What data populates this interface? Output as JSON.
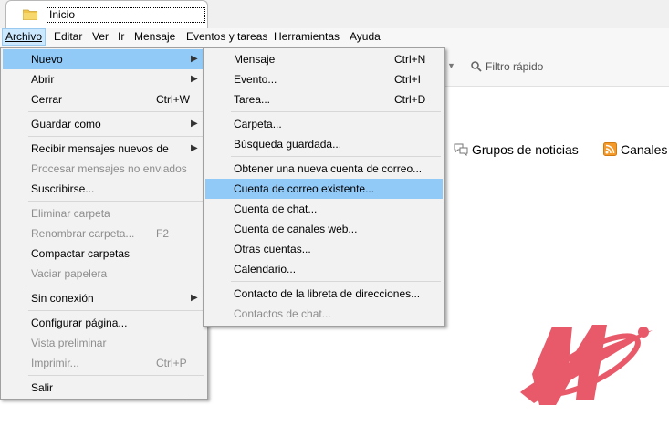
{
  "tab": {
    "title": "Inicio"
  },
  "menubar": [
    "Archivo",
    "Editar",
    "Ver",
    "Ir",
    "Mensaje",
    "Eventos y tareas",
    "Herramientas",
    "Ayuda"
  ],
  "background": {
    "quick_filter": "Filtro rápido",
    "newsgroups": "Grupos de noticias",
    "feeds": "Canales"
  },
  "archivo_menu": {
    "nuevo": "Nuevo",
    "abrir": "Abrir",
    "cerrar": "Cerrar",
    "cerrar_sc": "Ctrl+W",
    "guardar_como": "Guardar como",
    "recibir": "Recibir mensajes nuevos de",
    "procesar": "Procesar mensajes no enviados",
    "suscribirse": "Suscribirse...",
    "eliminar_carpeta": "Eliminar carpeta",
    "renombrar_carpeta": "Renombrar carpeta...",
    "renombrar_sc": "F2",
    "compactar": "Compactar carpetas",
    "vaciar_papelera": "Vaciar papelera",
    "sin_conexion": "Sin conexión",
    "configurar_pagina": "Configurar página...",
    "vista_preliminar": "Vista preliminar",
    "imprimir": "Imprimir...",
    "imprimir_sc": "Ctrl+P",
    "salir": "Salir"
  },
  "nuevo_menu": {
    "mensaje": "Mensaje",
    "mensaje_sc": "Ctrl+N",
    "evento": "Evento...",
    "evento_sc": "Ctrl+I",
    "tarea": "Tarea...",
    "tarea_sc": "Ctrl+D",
    "carpeta": "Carpeta...",
    "busqueda": "Búsqueda guardada...",
    "obtener_cuenta": "Obtener una nueva cuenta de correo...",
    "cuenta_existente": "Cuenta de correo existente...",
    "cuenta_chat": "Cuenta de chat...",
    "cuenta_canales": "Cuenta de canales web...",
    "otras_cuentas": "Otras cuentas...",
    "calendario": "Calendario...",
    "contacto": "Contacto de la libreta de direcciones...",
    "contactos_chat": "Contactos de chat..."
  }
}
